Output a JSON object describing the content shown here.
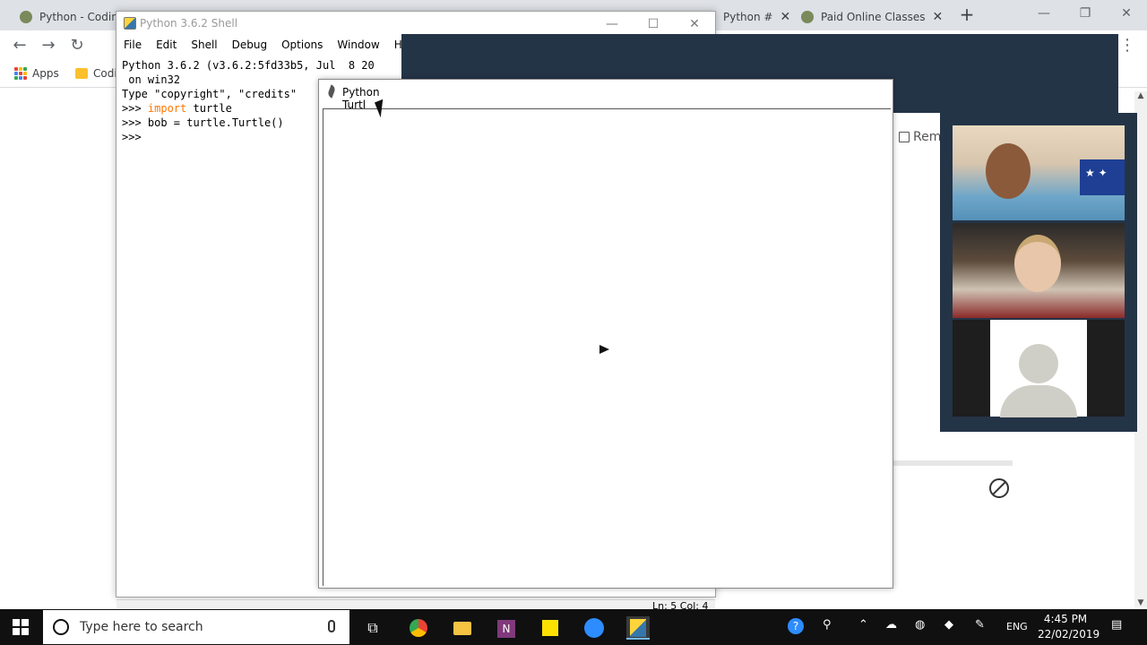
{
  "browser": {
    "tabs": [
      {
        "label": "Python - Coding"
      },
      {
        "label": "Python #"
      },
      {
        "label": "Paid Online Classes"
      }
    ],
    "new_tab": "+",
    "window_controls": {
      "minimize": "—",
      "restore": "❐",
      "close": "✕"
    },
    "nav": {
      "back": "←",
      "forward": "→",
      "reload": "↻",
      "menu": "⋮"
    },
    "bookmarks": [
      {
        "label": "Apps"
      },
      {
        "label": "Codi"
      }
    ]
  },
  "shell": {
    "title": "Python 3.6.2 Shell",
    "controls": {
      "minimize": "—",
      "maximize": "☐",
      "close": "✕"
    },
    "menu": [
      "File",
      "Edit",
      "Shell",
      "Debug",
      "Options",
      "Window",
      "Help"
    ],
    "lines": {
      "l1": "Python 3.6.2 (v3.6.2:5fd33b5, Jul  8 20",
      "l2": " on win32",
      "l3": "Type \"copyright\", \"credits\"",
      "l4_prompt": ">>> ",
      "l4_kw": "import",
      "l4_rest": " turtle",
      "l5": ">>> bob = turtle.Turtle()",
      "l6": ">>>"
    },
    "status": "Ln: 5   Col: 4"
  },
  "turtle": {
    "title": "Python Turtl"
  },
  "side_panel": {
    "rem_label": "Rem"
  },
  "taskbar": {
    "search_placeholder": "Type here to search",
    "language": "ENG",
    "time": "4:45 PM",
    "date": "22/02/2019"
  },
  "colors": {
    "dark_overlay": "#243447",
    "keyword": "#ff7700",
    "taskbar": "#101010"
  }
}
